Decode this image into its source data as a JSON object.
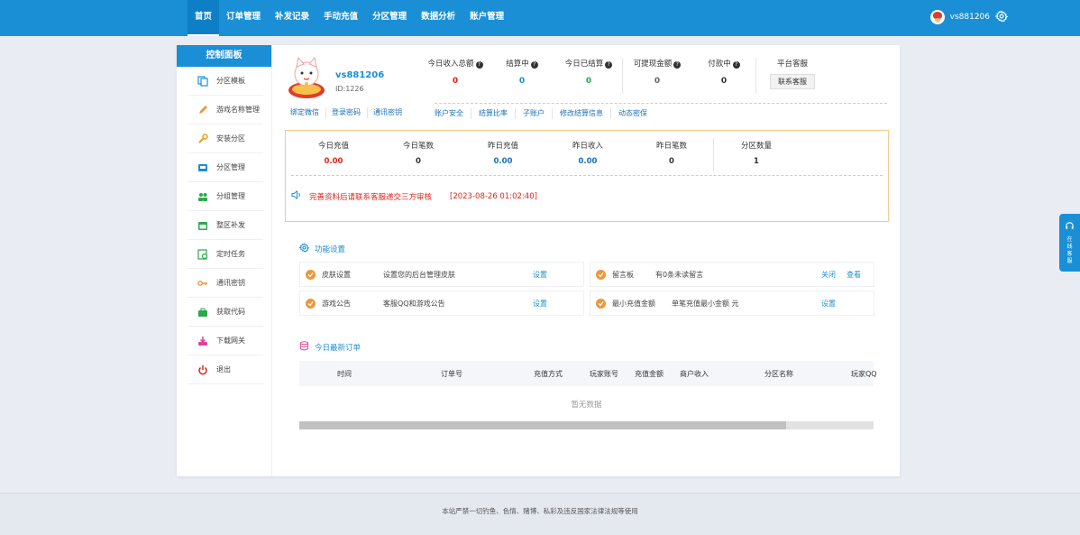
{
  "nav": {
    "items": [
      "首页",
      "订单管理",
      "补发记录",
      "手动充值",
      "分区管理",
      "数据分析",
      "账户管理"
    ],
    "user": "vs881206"
  },
  "sidebar": {
    "title": "控制面板",
    "items": [
      {
        "label": "分区模板",
        "icon": "copy-icon"
      },
      {
        "label": "游戏名称管理",
        "icon": "pencil-icon"
      },
      {
        "label": "安装分区",
        "icon": "wrench-icon"
      },
      {
        "label": "分区管理",
        "icon": "inbox-icon"
      },
      {
        "label": "分组管理",
        "icon": "users-icon"
      },
      {
        "label": "整区补发",
        "icon": "calendar-icon"
      },
      {
        "label": "定时任务",
        "icon": "schedule-icon"
      },
      {
        "label": "通讯密钥",
        "icon": "key-icon"
      },
      {
        "label": "获取代码",
        "icon": "briefcase-icon"
      },
      {
        "label": "下载网关",
        "icon": "download-icon"
      },
      {
        "label": "退出",
        "icon": "power-icon"
      }
    ]
  },
  "profile": {
    "name": "vs881206",
    "id": "ID:1226",
    "links": [
      "绑定微信",
      "登录密码",
      "通讯密钥"
    ]
  },
  "stats": {
    "items": [
      {
        "label": "今日收入总额",
        "value": "0",
        "color": "#e2231a",
        "help": true
      },
      {
        "label": "结算中",
        "value": "0",
        "color": "#1a8fd6",
        "help": true
      },
      {
        "label": "今日已结算",
        "value": "0",
        "color": "#2aa84a",
        "help": true
      },
      {
        "label": "可提现金额",
        "value": "0",
        "color": "#666666",
        "help": true
      },
      {
        "label": "付款中",
        "value": "0",
        "color": "#333333",
        "help": true
      }
    ],
    "service_label": "平台客服",
    "service_button": "联系客服",
    "links": [
      "账户安全",
      "结算比率",
      "子账户",
      "修改结算信息",
      "动态密保"
    ]
  },
  "today": {
    "items": [
      {
        "label": "今日充值",
        "value": "0.00",
        "color": "#e2231a"
      },
      {
        "label": "今日笔数",
        "value": "0",
        "color": "#333333"
      },
      {
        "label": "昨日充值",
        "value": "0.00",
        "color": "#1a6fb3"
      },
      {
        "label": "昨日收入",
        "value": "0.00",
        "color": "#1a6fb3"
      },
      {
        "label": "昨日笔数",
        "value": "0",
        "color": "#333333"
      },
      {
        "label": "分区数量",
        "value": "1",
        "color": "#333333"
      }
    ],
    "notice": "完善资料后请联系客服递交三方审核",
    "notice_time": "[2023-08-26 01:02:40]"
  },
  "functions": {
    "title": "功能设置",
    "items": [
      {
        "name": "皮肤设置",
        "desc": "设置您的后台管理皮肤",
        "actions": [
          "设置"
        ]
      },
      {
        "name": "留言板",
        "desc": "有0条未读留言",
        "actions": [
          "关闭",
          "查看"
        ]
      },
      {
        "name": "游戏公告",
        "desc": "客服QQ和游戏公告",
        "actions": [
          "设置"
        ]
      },
      {
        "name": "最小充值金额",
        "desc": "单笔充值最小金额 元",
        "actions": [
          "设置"
        ]
      }
    ]
  },
  "orders": {
    "title": "今日最新订单",
    "columns": [
      "时间",
      "订单号",
      "充值方式",
      "玩家账号",
      "充值金额",
      "商户收入",
      "分区名称",
      "玩家QQ"
    ],
    "empty": "暂无数据"
  },
  "footer": "本站严禁一切钓鱼、色情、赌博、私彩及违反国家法律法规等使用",
  "float_service": "在线客服"
}
